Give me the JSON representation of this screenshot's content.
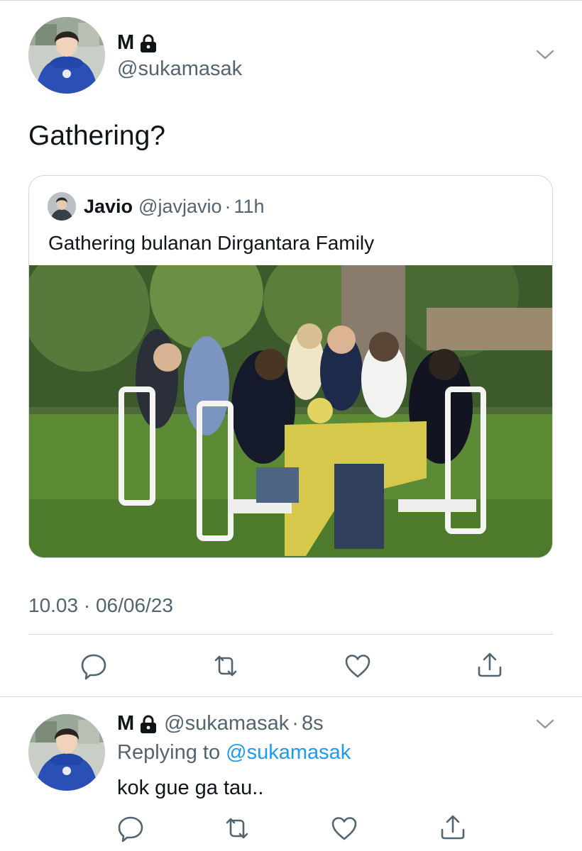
{
  "tweet": {
    "author_name": "M",
    "author_handle": "@sukamasak",
    "text": "Gathering?",
    "timestamp": "10.03 · 06/06/23"
  },
  "quoted": {
    "author_name": "Javio",
    "author_handle": "@javjavio",
    "separator": "·",
    "time": "11h",
    "text": "Gathering bulanan Dirgantara Family"
  },
  "reply": {
    "author_name": "M",
    "author_handle": "@sukamasak",
    "separator": "·",
    "time": "8s",
    "replying_prefix": "Replying to",
    "replying_handle": "@sukamasak",
    "text": "kok gue ga tau.."
  },
  "icons": {
    "lock": "lock-icon",
    "chevron": "chevron-down-icon",
    "reply": "comment-icon",
    "retweet": "retweet-icon",
    "like": "heart-icon",
    "share": "share-icon"
  },
  "colors": {
    "text": "#0f1419",
    "secondary": "#536471",
    "link": "#1d9bf0",
    "divider": "#d9d9d9"
  }
}
